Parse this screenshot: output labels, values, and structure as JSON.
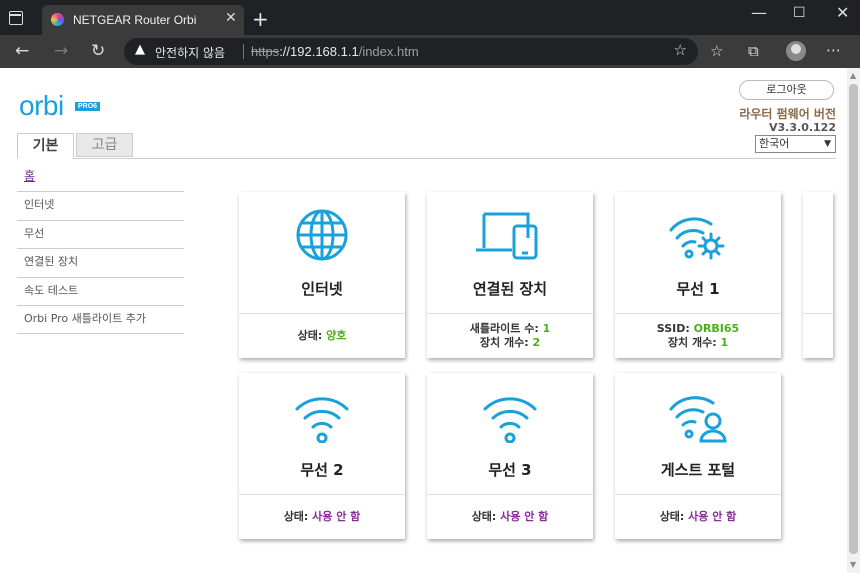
{
  "browser": {
    "tab_title": "NETGEAR Router Orbi",
    "security_label": "안전하지 않음",
    "url_scheme": "https",
    "url_host": "://192.168.1.1",
    "url_path": "/index.htm"
  },
  "header": {
    "logo_text": "orbi",
    "logo_badge": "PRO6",
    "logout_label": "로그아웃",
    "firmware_label": "라우터 펌웨어 버전",
    "firmware_version": "V3.3.0.122",
    "language": "한국어"
  },
  "tabs": {
    "basic": "기본",
    "advanced": "고급"
  },
  "menu": [
    {
      "label": "홈"
    },
    {
      "label": "인터넷"
    },
    {
      "label": "무선"
    },
    {
      "label": "연결된 장치"
    },
    {
      "label": "속도 테스트"
    },
    {
      "label": "Orbi Pro 새틀라이트 추가"
    }
  ],
  "cards": {
    "internet": {
      "title": "인터넷",
      "status_label": "상태: ",
      "status_value": "양호"
    },
    "devices": {
      "title": "연결된 장치",
      "sat_label": "새틀라이트 수: ",
      "sat_value": "1",
      "dev_label": "장치 개수: ",
      "dev_value": "2"
    },
    "wireless1": {
      "title": "무선 1",
      "ssid_label": "SSID: ",
      "ssid_value": "ORBI65",
      "dev_label": "장치 개수: ",
      "dev_value": "1"
    },
    "wireless2": {
      "title": "무선 2",
      "status_label": "상태: ",
      "status_value": "사용 안 함"
    },
    "wireless3": {
      "title": "무선 3",
      "status_label": "상태: ",
      "status_value": "사용 안 함"
    },
    "guest": {
      "title": "게스트 포털",
      "status_label": "상태: ",
      "status_value": "사용 안 함"
    }
  },
  "colors": {
    "accent": "#1aa0db",
    "ok": "#4caf1a",
    "disabled": "#8a2b9a",
    "menu_active": "#6b2d91"
  }
}
